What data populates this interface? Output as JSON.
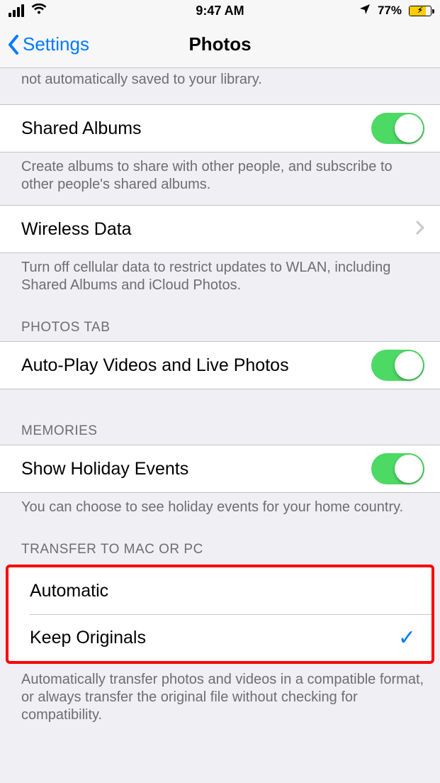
{
  "statusbar": {
    "time": "9:47 AM",
    "battery_percent": "77%",
    "battery_fill_pct": 77
  },
  "nav": {
    "back_label": "Settings",
    "title": "Photos"
  },
  "partial_footer_top": "not automatically saved to your library.",
  "shared_albums": {
    "label": "Shared Albums",
    "footer": "Create albums to share with other people, and subscribe to other people's shared albums."
  },
  "wireless_data": {
    "label": "Wireless Data",
    "footer": "Turn off cellular data to restrict updates to WLAN, including Shared Albums and iCloud Photos."
  },
  "photos_tab": {
    "header": "PHOTOS TAB",
    "autoplay_label": "Auto-Play Videos and Live Photos"
  },
  "memories": {
    "header": "MEMORIES",
    "holiday_label": "Show Holiday Events",
    "footer": "You can choose to see holiday events for your home country."
  },
  "transfer": {
    "header": "TRANSFER TO MAC OR PC",
    "option_automatic": "Automatic",
    "option_keep_originals": "Keep Originals",
    "footer": "Automatically transfer photos and videos in a compatible format, or always transfer the original file without checking for compatibility."
  }
}
